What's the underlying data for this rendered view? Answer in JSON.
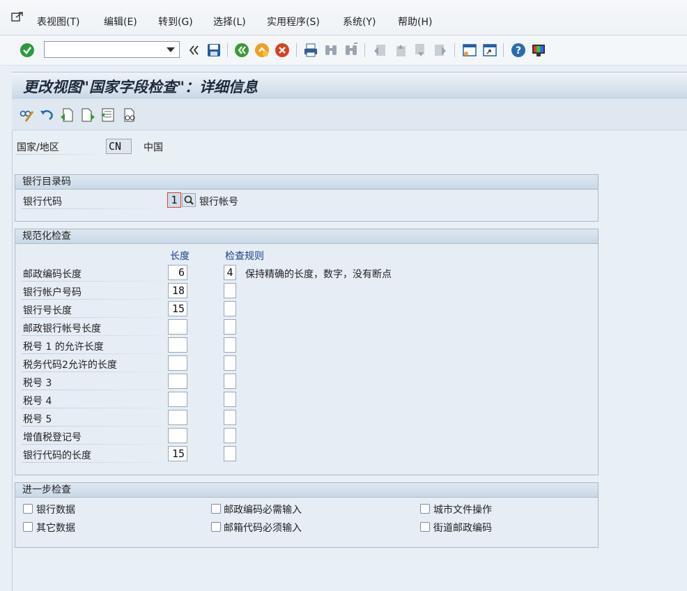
{
  "menu": {
    "items": [
      "表视图(T)",
      "编辑(E)",
      "转到(G)",
      "选择(L)",
      "实用程序(S)",
      "系统(Y)",
      "帮助(H)"
    ]
  },
  "toolbar": {
    "command_value": "",
    "icons": [
      "enter-icon",
      "command-dropdown-icon",
      "collapse-icon",
      "save-icon",
      "back-icon",
      "exit-icon",
      "cancel-icon",
      "print-icon",
      "find-icon",
      "find-next-icon",
      "first-page-icon",
      "previous-page-icon",
      "next-page-icon",
      "last-page-icon",
      "create-session-icon",
      "shortcut-icon",
      "help-icon",
      "customize-layout-icon"
    ]
  },
  "title": "更改视图\"国家字段检查\"：详细信息",
  "app_toolbar": {
    "icons": [
      "display-change-icon",
      "undo-icon",
      "previous-entry-icon",
      "next-entry-icon",
      "select-all-icon",
      "glasses-icon"
    ]
  },
  "country": {
    "label": "国家/地区",
    "code": "CN",
    "name": "中国"
  },
  "bank_dir": {
    "heading": "银行目录码",
    "label": "银行代码",
    "value": "1",
    "description": "银行帐号"
  },
  "format_checks": {
    "heading": "规范化检查",
    "col_length": "长度",
    "col_rule": "检查规则",
    "rows": [
      {
        "label": "邮政编码长度",
        "length": "6",
        "rule": "4",
        "rule_text": "保持精确的长度，数字，没有断点"
      },
      {
        "label": "银行帐户号码",
        "length": "18",
        "rule": "",
        "rule_text": ""
      },
      {
        "label": "银行号长度",
        "length": "15",
        "rule": "",
        "rule_text": ""
      },
      {
        "label": "邮政银行帐号长度",
        "length": "",
        "rule": "",
        "rule_text": ""
      },
      {
        "label": "税号 1 的允许长度",
        "length": "",
        "rule": "",
        "rule_text": ""
      },
      {
        "label": "税务代码2允许的长度",
        "length": "",
        "rule": "",
        "rule_text": ""
      },
      {
        "label": "税号 3",
        "length": "",
        "rule": "",
        "rule_text": ""
      },
      {
        "label": "税号 4",
        "length": "",
        "rule": "",
        "rule_text": ""
      },
      {
        "label": "税号 5",
        "length": "",
        "rule": "",
        "rule_text": ""
      },
      {
        "label": "增值税登记号",
        "length": "",
        "rule": "",
        "rule_text": ""
      },
      {
        "label": "银行代码的长度",
        "length": "15",
        "rule": "",
        "rule_text": ""
      }
    ]
  },
  "further_checks": {
    "heading": "进一步检查",
    "items": [
      {
        "label": "银行数据",
        "checked": false
      },
      {
        "label": "邮政编码必需输入",
        "checked": false
      },
      {
        "label": "城市文件操作",
        "checked": false
      },
      {
        "label": "其它数据",
        "checked": false
      },
      {
        "label": "邮箱代码必须输入",
        "checked": false
      },
      {
        "label": "街道邮政编码",
        "checked": false
      }
    ]
  }
}
